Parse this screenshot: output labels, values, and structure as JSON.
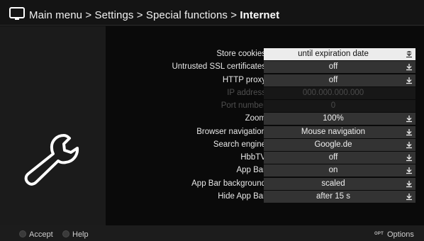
{
  "header": {
    "breadcrumb_path": "Main menu > Settings > Special functions >",
    "breadcrumb_current": "Internet",
    "icon": "tv-icon"
  },
  "left_panel": {
    "icon": "wrench-icon"
  },
  "settings": [
    {
      "label": "Store cookies",
      "value": "until expiration date",
      "selected": true,
      "enabled": true
    },
    {
      "label": "Untrusted SSL certificates",
      "value": "off",
      "selected": false,
      "enabled": true
    },
    {
      "label": "HTTP proxy",
      "value": "off",
      "selected": false,
      "enabled": true
    },
    {
      "label": "IP address",
      "value": "000.000.000.000",
      "selected": false,
      "enabled": false
    },
    {
      "label": "Port number",
      "value": "0",
      "selected": false,
      "enabled": false
    },
    {
      "label": "Zoom",
      "value": "100%",
      "selected": false,
      "enabled": true
    },
    {
      "label": "Browser navigation",
      "value": "Mouse navigation",
      "selected": false,
      "enabled": true
    },
    {
      "label": "Search engine",
      "value": "Google.de",
      "selected": false,
      "enabled": true
    },
    {
      "label": "HbbTV",
      "value": "off",
      "selected": false,
      "enabled": true
    },
    {
      "label": "App Bar",
      "value": "on",
      "selected": false,
      "enabled": true
    },
    {
      "label": "App Bar background",
      "value": "scaled",
      "selected": false,
      "enabled": true
    },
    {
      "label": "Hide App Bar",
      "value": "after 15 s",
      "selected": false,
      "enabled": true
    }
  ],
  "footer": {
    "accept_label": "Accept",
    "help_label": "Help",
    "opt_badge": "OPT",
    "options_label": "Options"
  }
}
